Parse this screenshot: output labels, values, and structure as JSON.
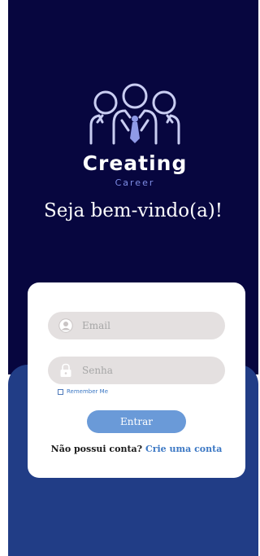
{
  "colors": {
    "top_background": "#07063f",
    "bottom_background": "#213d86",
    "card_background": "#ffffff",
    "input_background": "#e4e0e0",
    "button_background": "#6a9ad8",
    "link_color": "#3c78c4",
    "logo_stroke": "#c9cdf2",
    "logo_accent": "#8f9ae6",
    "subtitle_color": "#7f8ee6"
  },
  "brand": {
    "logo_icon": "team-people-icon",
    "name": "Creating",
    "subtitle": "Career"
  },
  "welcome": "Seja bem-vindo(a)!",
  "form": {
    "email": {
      "icon": "user-avatar-icon",
      "placeholder": "Email",
      "value": ""
    },
    "password": {
      "icon": "lock-icon",
      "placeholder": "Senha",
      "value": ""
    },
    "remember_label": "Remember Me",
    "remember_checked": false,
    "submit_label": "Entrar",
    "signup_prompt": "Não possui conta?",
    "signup_link": "Crie uma conta"
  }
}
